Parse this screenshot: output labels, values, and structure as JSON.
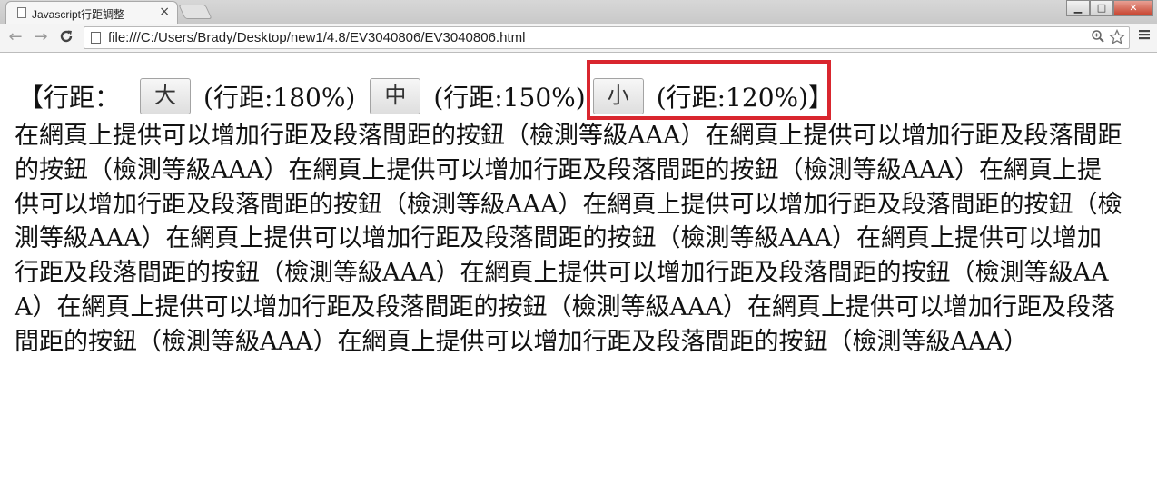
{
  "browser": {
    "tab_title": "Javascript行距調整",
    "tab_close": "×",
    "url": "file:///C:/Users/Brady/Desktop/new1/4.8/EV3040806/EV3040806.html",
    "nav": {
      "back": "←",
      "forward": "→",
      "reload": "C"
    },
    "window_controls": {
      "minimize": "▁",
      "maximize": "□",
      "close": "✕"
    },
    "icons": {
      "zoom": "zoom-icon",
      "star": "star-icon",
      "menu": "menu-icon"
    }
  },
  "page": {
    "open_bracket": "【行距：",
    "buttons": [
      {
        "label": "大",
        "desc": "(行距:180%)"
      },
      {
        "label": "中",
        "desc": "(行距:150%)"
      },
      {
        "label": "小",
        "desc": "(行距:120%)"
      }
    ],
    "close_bracket": "】",
    "paragraph": "在網頁上提供可以增加行距及段落間距的按鈕（檢測等級AAA）在網頁上提供可以增加行距及段落間距的按鈕（檢測等級AAA）在網頁上提供可以增加行距及段落間距的按鈕（檢測等級AAA）在網頁上提供可以增加行距及段落間距的按鈕（檢測等級AAA）在網頁上提供可以增加行距及段落間距的按鈕（檢測等級AAA）在網頁上提供可以增加行距及段落間距的按鈕（檢測等級AAA）在網頁上提供可以增加行距及段落間距的按鈕（檢測等級AAA）在網頁上提供可以增加行距及段落間距的按鈕（檢測等級AAA）在網頁上提供可以增加行距及段落間距的按鈕（檢測等級AAA）在網頁上提供可以增加行距及段落間距的按鈕（檢測等級AAA）在網頁上提供可以增加行距及段落間距的按鈕（檢測等級AAA）",
    "highlight_color": "#d9262e"
  }
}
